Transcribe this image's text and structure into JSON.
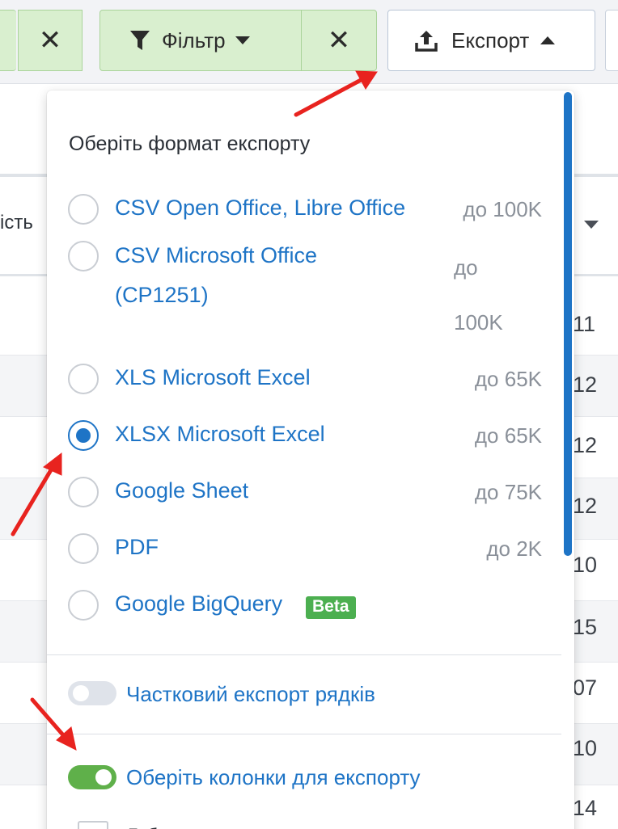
{
  "toolbar": {
    "filter_label": "Фільтр",
    "export_label": "Експорт"
  },
  "table": {
    "header_partial": "ість",
    "row_values": [
      "11",
      "12",
      "12",
      "12",
      "10",
      "15",
      "07",
      "10",
      "14"
    ]
  },
  "export_menu": {
    "title": "Оберіть формат експорту",
    "options": [
      {
        "label": "CSV Open Office, Libre Office",
        "limit": "до 100K",
        "selected": false
      },
      {
        "label": "CSV Microsoft Office (CP1251)",
        "limit_line1": "до",
        "limit_line2": "100K",
        "selected": false
      },
      {
        "label": "XLS Microsoft Excel",
        "limit": "до 65K",
        "selected": false
      },
      {
        "label": "XLSX Microsoft Excel",
        "limit": "до 65K",
        "selected": true
      },
      {
        "label": "Google Sheet",
        "limit": "до 75K",
        "selected": false
      },
      {
        "label": "PDF",
        "limit": "до 2K",
        "selected": false
      },
      {
        "label": "Google BigQuery",
        "badge": "Beta",
        "selected": false
      }
    ],
    "partial_export": {
      "label": "Частковий експорт рядків",
      "enabled": false
    },
    "choose_columns": {
      "label": "Оберіть колонки для експорту",
      "enabled": true
    },
    "column_item_partial": "Д б"
  },
  "colors": {
    "accent": "#1e74c6",
    "toggle_on": "#5fb04a",
    "filter_green": "#d9efcf",
    "beta_green": "#4caf50",
    "annotation_red": "#e8231f"
  }
}
